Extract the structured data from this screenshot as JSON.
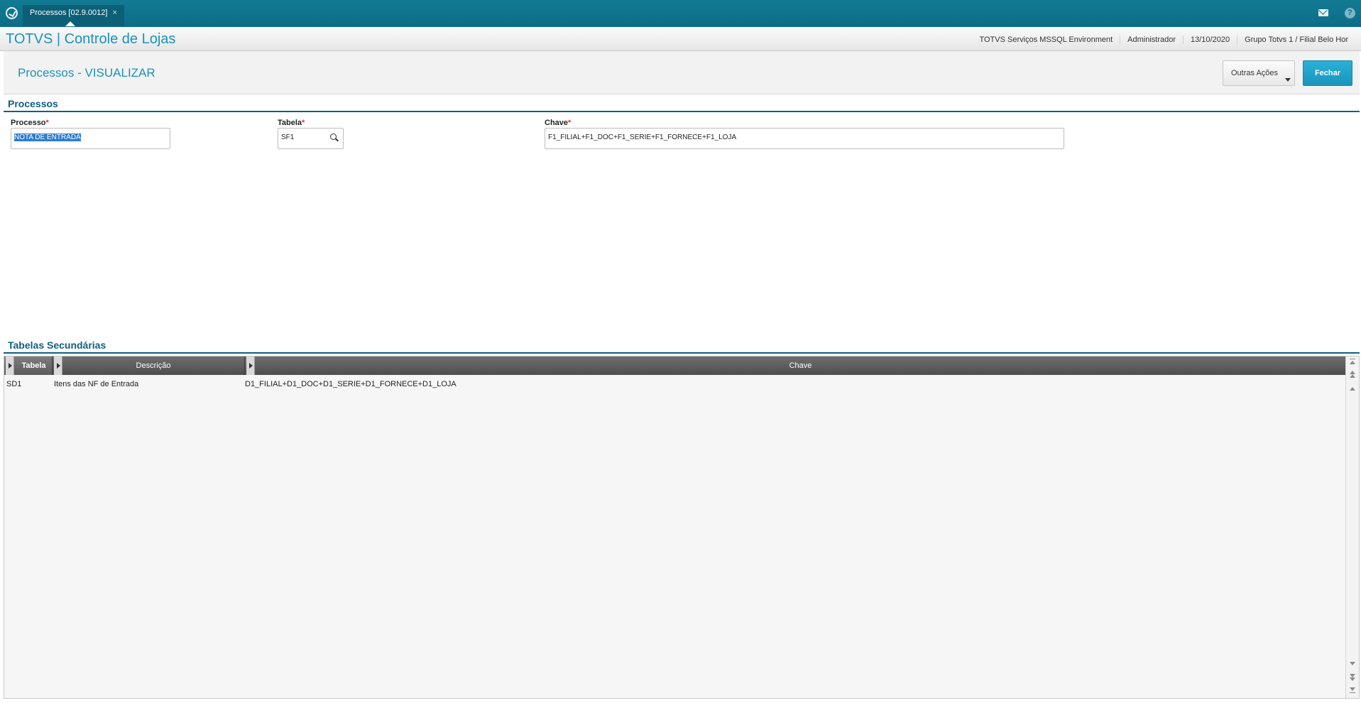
{
  "topbar": {
    "logo_icon": "totvs-logo-icon",
    "tab_label": "Processos [02.9.0012]",
    "tab_close": "×",
    "mail_icon": "mail-icon",
    "help_icon_glyph": "?"
  },
  "header": {
    "app_title": "TOTVS | Controle de Lojas",
    "environment": "TOTVS Serviços MSSQL Environment",
    "user": "Administrador",
    "date": "13/10/2020",
    "branch": "Grupo Totvs 1 / Filial Belo Hor"
  },
  "page": {
    "title": "Processos - VISUALIZAR",
    "outras_acoes_label": "Outras Ações",
    "fechar_label": "Fechar"
  },
  "form": {
    "section_title": "Processos",
    "processo": {
      "label": "Processo",
      "required": "*",
      "value": "NOTA DE ENTRADA"
    },
    "tabela": {
      "label": "Tabela",
      "required": "*",
      "value": "SF1"
    },
    "chave": {
      "label": "Chave",
      "required": "*",
      "value": "F1_FILIAL+F1_DOC+F1_SERIE+F1_FORNECE+F1_LOJA"
    }
  },
  "secondary": {
    "section_title": "Tabelas Secundárias",
    "columns": [
      "Tabela",
      "Descrição",
      "Chave"
    ],
    "rows": [
      {
        "tabela": "SD1",
        "descricao": "Itens das NF de Entrada",
        "chave": "D1_FILIAL+D1_DOC+D1_SERIE+D1_FORNECE+D1_LOJA"
      }
    ]
  },
  "colors": {
    "topbar": "#0e7490",
    "accent": "#1a93b8",
    "section": "#0f5f7f",
    "button_primary": "#1a95bd",
    "required": "#e03030"
  }
}
